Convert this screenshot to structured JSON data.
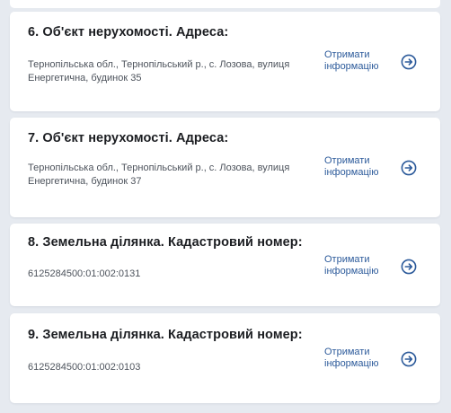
{
  "cards": [
    {
      "title": "6. Об'єкт нерухомості. Адреса:",
      "value": "Тернопільська обл., Тернопільський р., с. Лозова, вулиця Енергетична, будинок 35",
      "action_label": "Отримати інформацію"
    },
    {
      "title": "7. Об'єкт нерухомості. Адреса:",
      "value": "Тернопільська обл., Тернопільський р., с. Лозова, вулиця Енергетична, будинок 37",
      "action_label": "Отримати інформацію"
    },
    {
      "title": "8. Земельна ділянка. Кадастровий номер:",
      "value": "6125284500:01:002:0131",
      "action_label": "Отримати інформацію"
    },
    {
      "title": "9. Земельна ділянка. Кадастровий номер:",
      "value": "6125284500:01:002:0103",
      "action_label": "Отримати інформацію"
    }
  ],
  "icons": {
    "action": "arrow-right-circle-icon"
  },
  "colors": {
    "background": "#e6eaf0",
    "card": "#ffffff",
    "title": "#1b1d21",
    "value": "#4d535c",
    "link": "#2d5b9b"
  }
}
